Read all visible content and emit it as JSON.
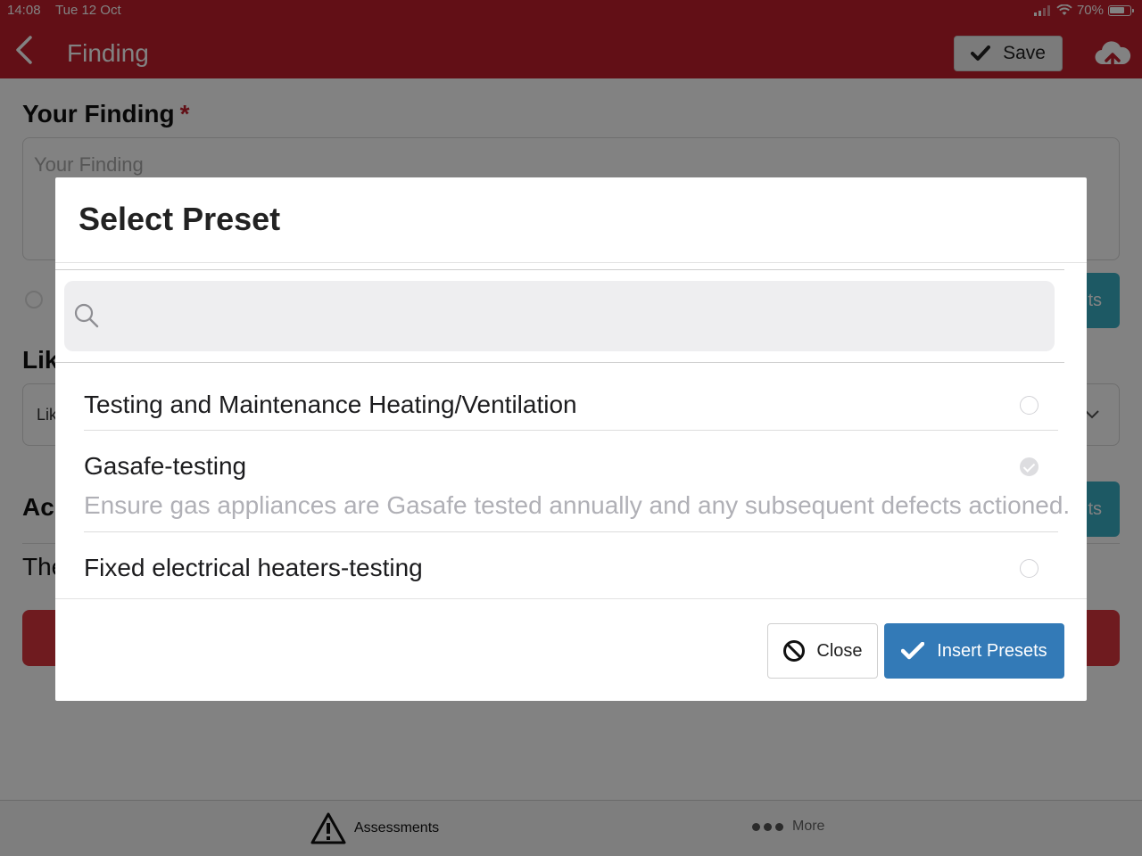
{
  "status_bar": {
    "time": "14:08",
    "date": "Tue 12 Oct",
    "battery": "70%"
  },
  "nav": {
    "title": "Finding",
    "save_label": "Save"
  },
  "background": {
    "finding_label": "Your Finding",
    "required_mark": "*",
    "finding_placeholder": "Your Finding",
    "teal_button_fragment": "ts",
    "likelihood_label_fragment": "Lik",
    "likelihood_select_fragment": "Lik",
    "action_label_fragment": "Ac",
    "action_text_fragment": "The",
    "teal_button2_fragment": "ts"
  },
  "tabbar": {
    "assessments": "Assessments",
    "more": "More"
  },
  "modal": {
    "title": "Select Preset",
    "search_value": "",
    "items": [
      {
        "title": "Testing and Maintenance Heating/Ventilation",
        "subtitle": "",
        "selected": false
      },
      {
        "title": "Gasafe-testing",
        "subtitle": "Ensure gas appliances are Gasafe tested annually and any subsequent defects actioned.",
        "selected": true
      },
      {
        "title": "Fixed electrical heaters-testing",
        "subtitle": "",
        "selected": false
      }
    ],
    "close_label": "Close",
    "insert_label": "Insert Presets"
  },
  "colors": {
    "brand_red": "#c11f2b",
    "primary_blue": "#337ab7",
    "teal": "#3aaec5"
  }
}
